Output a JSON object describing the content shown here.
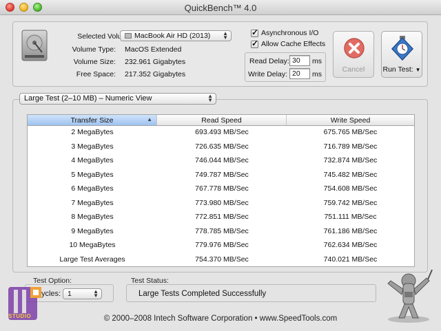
{
  "window": {
    "title": "QuickBench™ 4.0"
  },
  "volume": {
    "selected_label": "Selected Volume:",
    "selected_value": "MacBook Air HD (2013)",
    "type_label": "Volume Type:",
    "type_value": "MacOS Extended",
    "size_label": "Volume Size:",
    "size_value": "232.961 Gigabytes",
    "free_label": "Free Space:",
    "free_value": "217.352 Gigabytes"
  },
  "options": {
    "async_label": "Asynchronous I/O",
    "async_checked": true,
    "cache_label": "Allow Cache Effects",
    "cache_checked": true,
    "read_delay_label": "Read Delay:",
    "read_delay_value": "30",
    "write_delay_label": "Write Delay:",
    "write_delay_value": "20",
    "unit_ms": "ms"
  },
  "buttons": {
    "cancel": "Cancel",
    "run_test": "Run Test:"
  },
  "view": {
    "selected": "Large Test (2–10 MB) – Numeric View"
  },
  "table": {
    "headers": [
      "Transfer Size",
      "Read Speed",
      "Write Speed"
    ],
    "rows": [
      [
        "2 MegaBytes",
        "693.493 MB/Sec",
        "675.765 MB/Sec"
      ],
      [
        "3 MegaBytes",
        "726.635 MB/Sec",
        "716.789 MB/Sec"
      ],
      [
        "4 MegaBytes",
        "746.044 MB/Sec",
        "732.874 MB/Sec"
      ],
      [
        "5 MegaBytes",
        "749.787 MB/Sec",
        "745.482 MB/Sec"
      ],
      [
        "6 MegaBytes",
        "767.778 MB/Sec",
        "754.608 MB/Sec"
      ],
      [
        "7 MegaBytes",
        "773.980 MB/Sec",
        "759.742 MB/Sec"
      ],
      [
        "8 MegaBytes",
        "772.851 MB/Sec",
        "751.111 MB/Sec"
      ],
      [
        "9 MegaBytes",
        "778.785 MB/Sec",
        "761.186 MB/Sec"
      ],
      [
        "10 MegaBytes",
        "779.976 MB/Sec",
        "762.634 MB/Sec"
      ],
      [
        "Large Test Averages",
        "754.370 MB/Sec",
        "740.021 MB/Sec"
      ]
    ]
  },
  "bottom": {
    "test_option_label": "Test Option:",
    "cycles_label": "Cycles:",
    "cycles_value": "1",
    "test_status_label": "Test Status:",
    "status_text": "Large Tests Completed Successfully"
  },
  "footer": "© 2000–2008 Intech Software Corporation • www.SpeedTools.com",
  "watermark": {
    "text": "STUDIO"
  },
  "colors": {
    "accent_blue": "#3d79c8",
    "cancel_red": "#d9423a",
    "selection": "#a6c8f0"
  }
}
